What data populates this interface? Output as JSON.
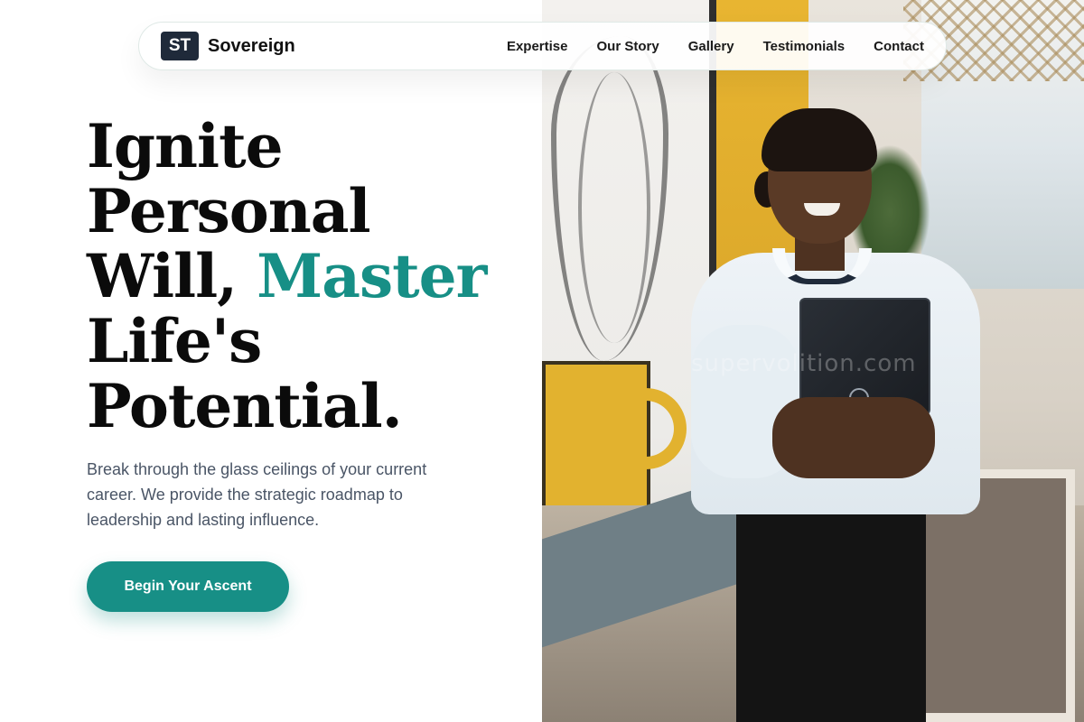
{
  "brand": {
    "mark": "ST",
    "name": "Sovereign"
  },
  "nav": {
    "links": [
      {
        "label": "Expertise"
      },
      {
        "label": "Our Story"
      },
      {
        "label": "Gallery"
      },
      {
        "label": "Testimonials"
      },
      {
        "label": "Contact"
      }
    ]
  },
  "hero": {
    "title_line1": "Ignite",
    "title_line2": "Personal",
    "title_line3a": "Will, ",
    "title_line3b": "Master",
    "title_line4": "Life's",
    "title_line5": "Potential.",
    "subtitle": "Break through the glass ceilings of your current career. We provide the strategic roadmap to leadership and lasting influence.",
    "cta_label": "Begin Your Ascent"
  },
  "photo": {
    "watermark": "supervolition.com"
  },
  "colors": {
    "accent": "#178f86",
    "brand_mark_bg": "#1f2a3a"
  }
}
